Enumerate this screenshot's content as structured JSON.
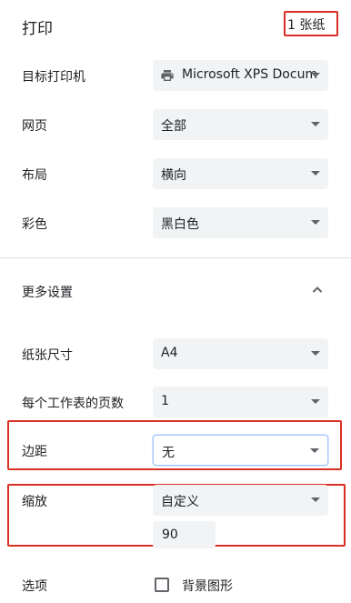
{
  "header": {
    "title": "打印",
    "sheet_count": "1 张纸"
  },
  "settings": {
    "printer": {
      "label": "目标打印机",
      "value": "Microsoft XPS Docum"
    },
    "pages": {
      "label": "网页",
      "value": "全部"
    },
    "layout": {
      "label": "布局",
      "value": "横向"
    },
    "color": {
      "label": "彩色",
      "value": "黑白色"
    }
  },
  "more_settings": {
    "label": "更多设置"
  },
  "advanced": {
    "paper_size": {
      "label": "纸张尺寸",
      "value": "A4"
    },
    "pages_per_sheet": {
      "label": "每个工作表的页数",
      "value": "1"
    },
    "margins": {
      "label": "边距",
      "value": "无"
    },
    "scale": {
      "label": "缩放",
      "value": "自定义",
      "custom_value": "90"
    },
    "options": {
      "label": "选项",
      "checkbox_label": "背景图形",
      "checked": false
    }
  },
  "colors": {
    "highlight": "#d93025",
    "field_bg": "#f1f3f4",
    "focus_border": "#a8c7fa"
  },
  "icons": {
    "printer": "printer-icon",
    "collapse": "chevron-up-icon",
    "dropdown": "caret-down-icon"
  }
}
